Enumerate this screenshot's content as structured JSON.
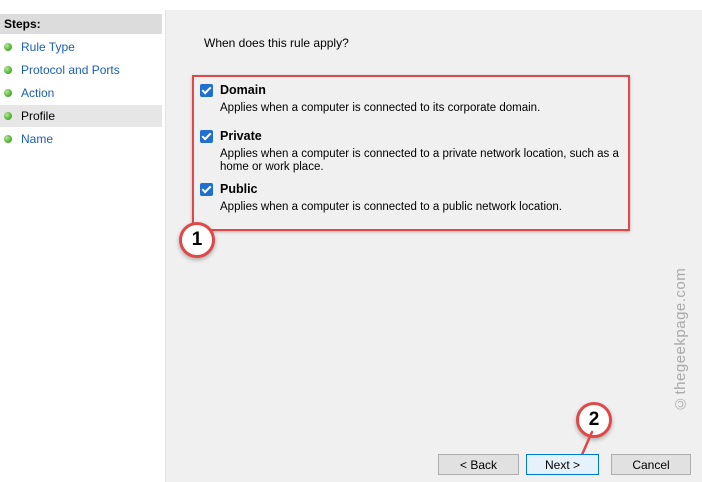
{
  "sidebar": {
    "title": "Steps:",
    "items": [
      {
        "label": "Rule Type"
      },
      {
        "label": "Protocol and Ports"
      },
      {
        "label": "Action"
      },
      {
        "label": "Profile"
      },
      {
        "label": "Name"
      }
    ],
    "active_index": 3
  },
  "main": {
    "question": "When does this rule apply?",
    "options": [
      {
        "title": "Domain",
        "checked": true,
        "description": "Applies when a computer is connected to its corporate domain."
      },
      {
        "title": "Private",
        "checked": true,
        "description": "Applies when a computer is connected to a private network location, such as a home or work place."
      },
      {
        "title": "Public",
        "checked": true,
        "description": "Applies when a computer is connected to a public network location."
      }
    ]
  },
  "annotations": {
    "badge1": "1",
    "badge2": "2",
    "color": "#e04848"
  },
  "watermark": "©thegeekpage.com",
  "buttons": {
    "back": "< Back",
    "next": "Next >",
    "cancel": "Cancel"
  },
  "colors": {
    "accent": "#1f6fce",
    "step_dot": "#5bb83a",
    "link": "#1a5fb4"
  }
}
